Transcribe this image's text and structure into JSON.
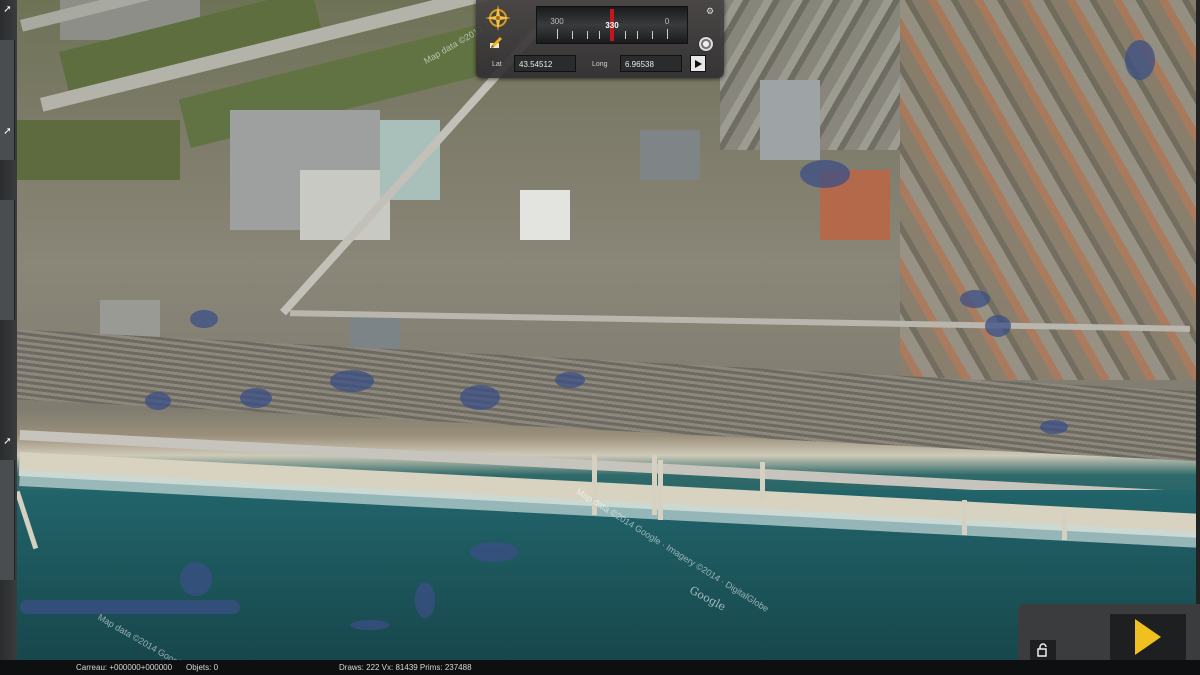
{
  "map": {
    "attribution_1": "Map data ©2014 Google",
    "attribution_2": "Map data ©2014 Google · Imagery ©2014 · DigitalGlobe",
    "attribution_3": "Map data ©2014",
    "google_logo": "Google"
  },
  "nav_panel": {
    "heading_value": "330",
    "heading_ticks": [
      "300",
      "330",
      "0"
    ],
    "lat_label": "Lat",
    "lat_value": "43.54512",
    "long_label": "Long",
    "long_value": "6.96538",
    "icons": {
      "compass": "compass-rose-icon",
      "edit": "pencil-icon",
      "reset": "center-target-icon",
      "go": "play-arrow-icon",
      "corner": "gear-icon"
    },
    "needle_color": "#c4161c"
  },
  "controls": {
    "lock_icon": "unlock-icon",
    "play_icon": "play-icon",
    "play_color": "#f0c020"
  },
  "status": {
    "tile": "Carreau: +000000+000000",
    "objects": "Objets: 0",
    "stats": "Draws: 222 Vx: 81439 Prims: 237488"
  }
}
